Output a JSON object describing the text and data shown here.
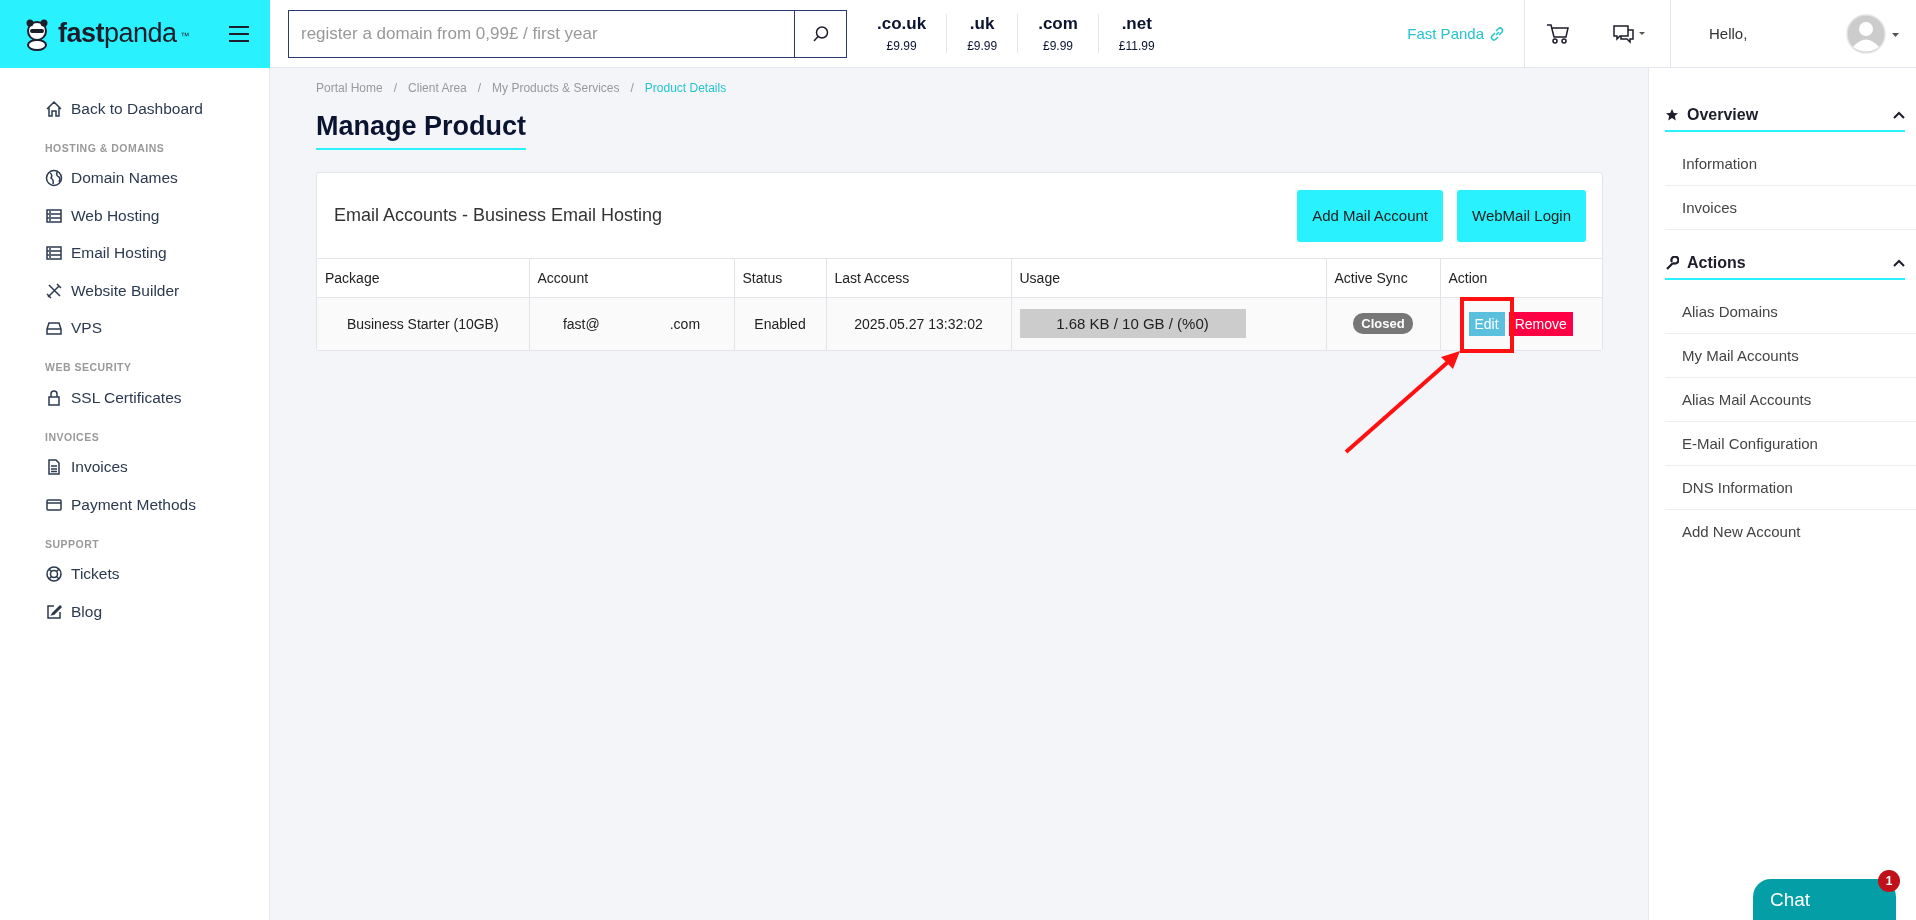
{
  "header": {
    "logo": "**fast**panda",
    "logo_mark": "™",
    "search": {
      "placeholder": "register a domain from 0,99£ / first year"
    },
    "tlds": [
      {
        "name": ".co.uk",
        "price": "£9.99"
      },
      {
        "name": ".uk",
        "price": "£9.99"
      },
      {
        "name": ".com",
        "price": "£9.99"
      },
      {
        "name": ".net",
        "price": "£11.99"
      }
    ],
    "brand_link": "Fast Panda",
    "greeting": "Hello,"
  },
  "sidebar": {
    "back_link": "Back to Dashboard",
    "sections": [
      {
        "heading": "HOSTING & DOMAINS",
        "items": [
          "Domain Names",
          "Web Hosting",
          "Email Hosting",
          "Website Builder",
          "VPS"
        ]
      },
      {
        "heading": "WEB SECURITY",
        "items": [
          "SSL Certificates"
        ]
      },
      {
        "heading": "INVOICES",
        "items": [
          "Invoices",
          "Payment Methods"
        ]
      },
      {
        "heading": "SUPPORT",
        "items": [
          "Tickets",
          "Blog"
        ]
      }
    ]
  },
  "breadcrumb": [
    {
      "label": "Portal Home",
      "selected": false
    },
    {
      "separator": "/",
      "label": "Client Area",
      "selected": false
    },
    {
      "separator": "/",
      "label": "My Products & Services",
      "selected": false
    },
    {
      "separator": "/",
      "label": "Product Details",
      "selected": true
    }
  ],
  "page_title": "Manage Product",
  "card": {
    "title": "Email Accounts - Business Email Hosting",
    "buttons": [
      "Add Mail Account",
      "WebMail Login"
    ],
    "table": {
      "columns": [
        "Package",
        "Account",
        "Status",
        "Last Access",
        "Usage",
        "Active Sync",
        "Action"
      ],
      "rows": [
        {
          "package": "Business Starter (10GB)",
          "account_user": "fast@",
          "account_domain": ".com",
          "status": "Enabled",
          "last_access": "2025.05.27 13:32:02",
          "usage": {
            "level": 0,
            "reading": "1.68 KB / 10 GB / (%0)"
          },
          "active_sync": "Closed",
          "actions": [
            {
              "label": "Edit",
              "kind": "edit"
            },
            {
              "label": "Remove",
              "kind": "remove"
            }
          ]
        }
      ]
    }
  },
  "right_panel": [
    {
      "title": "Overview",
      "expanded": true,
      "items": [
        "Information",
        "Invoices"
      ]
    },
    {
      "title": "Actions",
      "expanded": true,
      "items": [
        "Alias Domains",
        "My Mail Accounts",
        "Alias Mail Accounts",
        "E-Mail Configuration",
        "DNS Information",
        "Add New Account"
      ]
    }
  ],
  "chat": {
    "label": "Chat",
    "badge": "1"
  }
}
